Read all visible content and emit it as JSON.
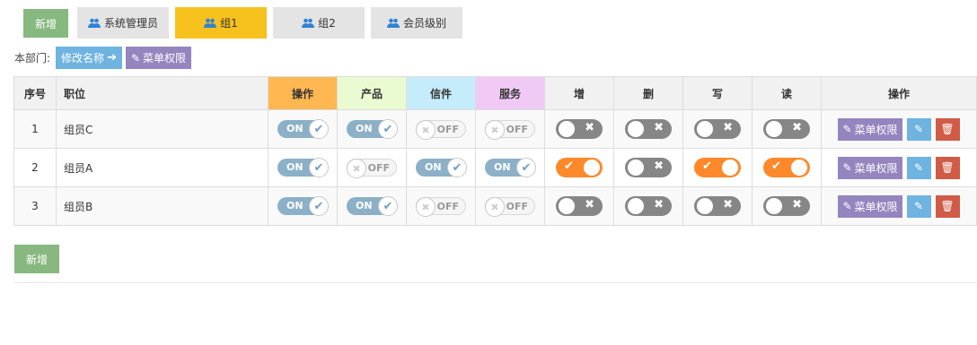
{
  "toolbar": {
    "new_label": "新增",
    "tabs": [
      {
        "label": "系统管理员",
        "active": false
      },
      {
        "label": "组1",
        "active": true
      },
      {
        "label": "组2",
        "active": false
      },
      {
        "label": "会员级别",
        "active": false
      }
    ]
  },
  "dept": {
    "label": "本部门:",
    "rename_label": "修改名称",
    "menu_perm_label": "菜单权限"
  },
  "table": {
    "headers": [
      "序号",
      "职位",
      "操作",
      "产品",
      "信件",
      "服务",
      "增",
      "删",
      "写",
      "读",
      "操作"
    ],
    "header_colors": {
      "操作": "#ffb752",
      "产品": "#eafbd1",
      "信件": "#c5ecfb",
      "服务": "#f0c9f5"
    },
    "switch_on_text": "ON",
    "switch_off_text": "OFF",
    "perm_button_label": "菜单权限",
    "rows": [
      {
        "index": "1",
        "position": "组员C",
        "op": true,
        "prod": true,
        "mail": false,
        "serv": false,
        "add": false,
        "del": false,
        "write": false,
        "read": false
      },
      {
        "index": "2",
        "position": "组员A",
        "op": true,
        "prod": false,
        "mail": true,
        "serv": true,
        "add": true,
        "del": false,
        "write": true,
        "read": true
      },
      {
        "index": "3",
        "position": "组员B",
        "op": true,
        "prod": true,
        "mail": false,
        "serv": false,
        "add": false,
        "del": false,
        "write": false,
        "read": false
      }
    ]
  },
  "footer": {
    "new_label": "新增"
  },
  "colors": {
    "green": "#87b87f",
    "yellow": "#f7c11d",
    "blue": "#6fb3e0",
    "purple": "#9585bf",
    "red": "#d15b47",
    "orange": "#ff892a"
  }
}
